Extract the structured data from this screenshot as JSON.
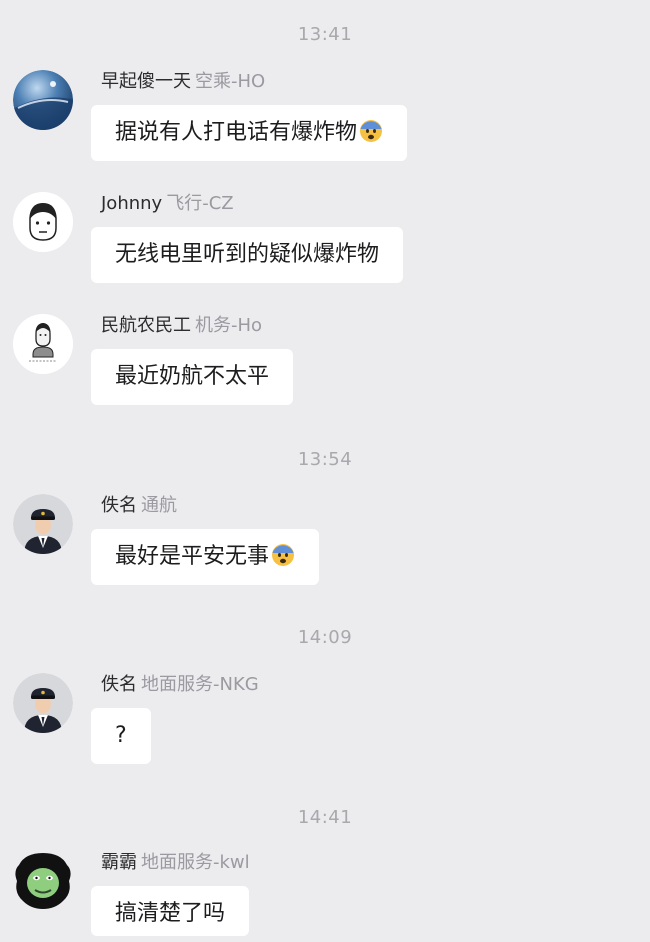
{
  "timestamps": [
    "13:41",
    "13:54",
    "14:09",
    "14:41"
  ],
  "messages": [
    {
      "name": "早起傻一天",
      "role": "空乘-HO",
      "text": "据说有人打电话有爆炸物",
      "emoji": "fearful-face-emoji"
    },
    {
      "name": "Johnny",
      "role": "飞行-CZ",
      "text": "无线电里听到的疑似爆炸物"
    },
    {
      "name": "民航农民工",
      "role": "机务-Ho",
      "text": "最近奶航不太平"
    },
    {
      "name": "佚名",
      "role": "通航",
      "text": "最好是平安无事",
      "emoji": "fearful-face-emoji"
    },
    {
      "name": "佚名",
      "role": "地面服务-NKG",
      "text": "?"
    },
    {
      "name": "霸霸",
      "role": "地面服务-kwl",
      "text": "搞清楚了吗"
    }
  ],
  "avatar_icons": [
    "earth-sky-avatar",
    "cartoon-man-avatar",
    "cartoon-worker-avatar",
    "pilot-avatar",
    "pilot-avatar",
    "meme-face-avatar"
  ],
  "colors": {
    "background": "#ececef",
    "bubble": "#ffffff",
    "name_text": "#2c2c2e",
    "role_text": "#9a9aa0",
    "timestamp_text": "#a8a8ad"
  }
}
